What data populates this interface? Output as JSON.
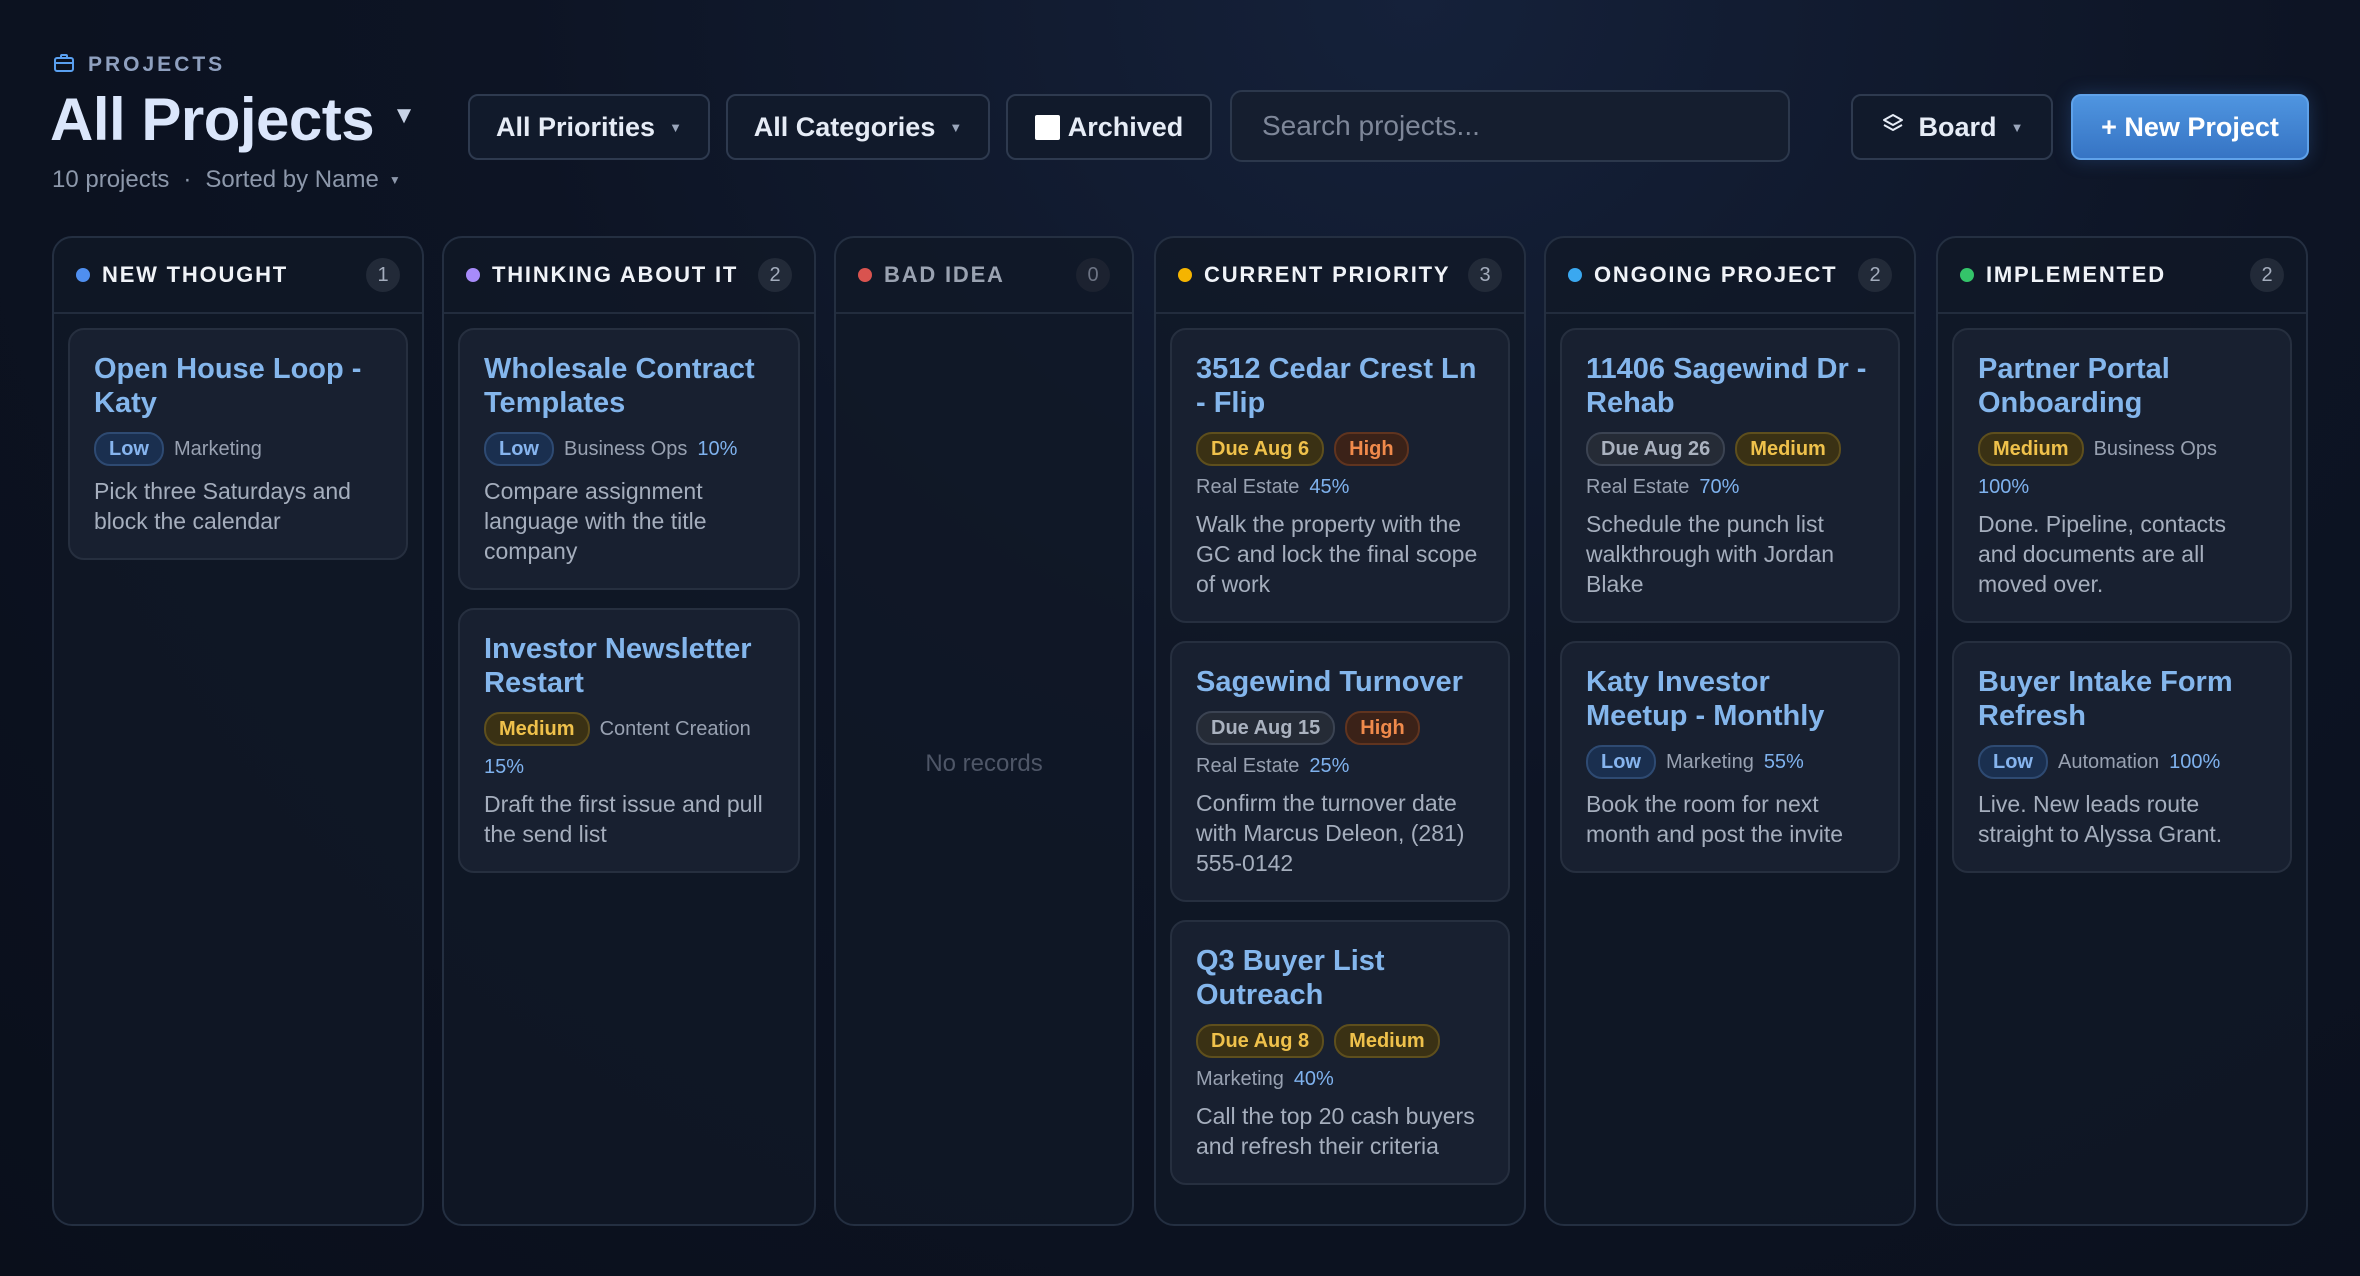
{
  "header": {
    "eyebrow": "PROJECTS",
    "title": "All Projects",
    "count_text": "10 projects",
    "separator": "·",
    "sort_label": "Sorted by Name"
  },
  "toolbar": {
    "priorities": "All Priorities",
    "categories": "All Categories",
    "archived": "Archived",
    "search_placeholder": "Search projects...",
    "view": "Board",
    "new_project": "+ New Project"
  },
  "colors": {
    "accent": "#3f82d0",
    "new_thought": "#4f8ff0",
    "thinking": "#a78bfa",
    "bad_idea": "#d9534f",
    "current_priority": "#f5b400",
    "ongoing": "#3aa8f0",
    "implemented": "#34c46a"
  },
  "columns": [
    {
      "key": "new_thought",
      "title": "NEW THOUGHT",
      "count": "1",
      "cards": [
        {
          "title": "Open House Loop - Katy",
          "badges": [
            {
              "text": "Low",
              "kind": "low"
            }
          ],
          "category": "Marketing",
          "progress": "",
          "description": "Pick three Saturdays and block the calendar"
        }
      ]
    },
    {
      "key": "thinking",
      "title": "THINKING ABOUT IT",
      "count": "2",
      "cards": [
        {
          "title": "Wholesale Contract Templates",
          "badges": [
            {
              "text": "Low",
              "kind": "low"
            }
          ],
          "category": "Business Ops",
          "progress": "10%",
          "description": "Compare assignment language with the title company"
        },
        {
          "title": "Investor Newsletter Restart",
          "badges": [
            {
              "text": "Medium",
              "kind": "med"
            }
          ],
          "category": "Content Creation",
          "progress": "15%",
          "description": "Draft the first issue and pull the send list"
        }
      ]
    },
    {
      "key": "bad_idea",
      "title": "BAD IDEA",
      "count": "0",
      "empty_text": "No records",
      "cards": []
    },
    {
      "key": "current_priority",
      "title": "CURRENT PRIORITY",
      "count": "3",
      "cards": [
        {
          "title": "3512 Cedar Crest Ln - Flip",
          "badges": [
            {
              "text": "Due Aug 6",
              "kind": "due-amber"
            },
            {
              "text": "High",
              "kind": "high"
            }
          ],
          "category": "Real Estate",
          "progress": "45%",
          "description": "Walk the property with the GC and lock the final scope of work"
        },
        {
          "title": "Sagewind Turnover",
          "badges": [
            {
              "text": "Due Aug 15",
              "kind": "due-gray"
            },
            {
              "text": "High",
              "kind": "high"
            }
          ],
          "category": "Real Estate",
          "progress": "25%",
          "description": "Confirm the turnover date with Marcus Deleon, (281) 555-0142"
        },
        {
          "title": "Q3 Buyer List Outreach",
          "badges": [
            {
              "text": "Due Aug 8",
              "kind": "due-amber"
            },
            {
              "text": "Medium",
              "kind": "med"
            }
          ],
          "category": "Marketing",
          "progress": "40%",
          "description": "Call the top 20 cash buyers and refresh their criteria"
        }
      ]
    },
    {
      "key": "ongoing",
      "title": "ONGOING PROJECT",
      "count": "2",
      "cards": [
        {
          "title": "11406 Sagewind Dr - Rehab",
          "badges": [
            {
              "text": "Due Aug 26",
              "kind": "due-gray"
            },
            {
              "text": "Medium",
              "kind": "med"
            }
          ],
          "category": "Real Estate",
          "progress": "70%",
          "description": "Schedule the punch list walkthrough with Jordan Blake"
        },
        {
          "title": "Katy Investor Meetup - Monthly",
          "badges": [
            {
              "text": "Low",
              "kind": "low"
            }
          ],
          "category": "Marketing",
          "progress": "55%",
          "description": "Book the room for next month and post the invite"
        }
      ]
    },
    {
      "key": "implemented",
      "title": "IMPLEMENTED",
      "count": "2",
      "cards": [
        {
          "title": "Partner Portal Onboarding",
          "badges": [
            {
              "text": "Medium",
              "kind": "med"
            }
          ],
          "category": "Business Ops",
          "progress": "100%",
          "description": "Done. Pipeline, contacts and documents are all moved over."
        },
        {
          "title": "Buyer Intake Form Refresh",
          "badges": [
            {
              "text": "Low",
              "kind": "low"
            }
          ],
          "category": "Automation",
          "progress": "100%",
          "description": "Live. New leads route straight to Alyssa Grant."
        }
      ]
    }
  ]
}
